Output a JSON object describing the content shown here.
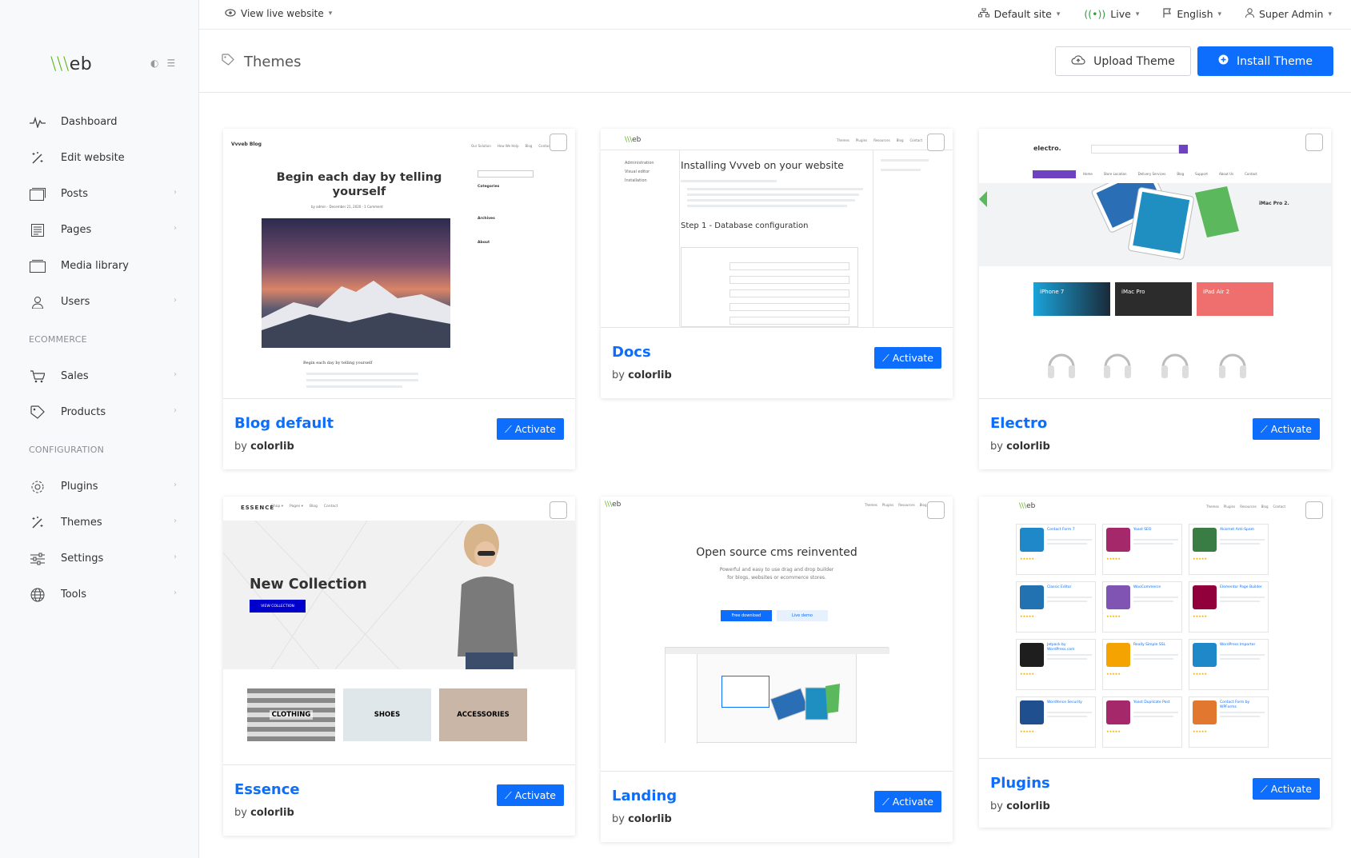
{
  "sidebar": {
    "logo": "Vvveb",
    "items": [
      {
        "label": "Dashboard",
        "icon": "activity-icon",
        "has_children": false
      },
      {
        "label": "Edit website",
        "icon": "magic-wand-icon",
        "has_children": false
      },
      {
        "label": "Posts",
        "icon": "posts-icon",
        "has_children": true
      },
      {
        "label": "Pages",
        "icon": "pages-icon",
        "has_children": true
      },
      {
        "label": "Media library",
        "icon": "media-icon",
        "has_children": false
      },
      {
        "label": "Users",
        "icon": "user-icon",
        "has_children": true
      }
    ],
    "section_ecommerce": "ECOMMERCE",
    "ecommerce_items": [
      {
        "label": "Sales",
        "icon": "cart-icon",
        "has_children": true
      },
      {
        "label": "Products",
        "icon": "tag-icon",
        "has_children": true
      }
    ],
    "section_configuration": "CONFIGURATION",
    "config_items": [
      {
        "label": "Plugins",
        "icon": "gear-icon",
        "has_children": true
      },
      {
        "label": "Themes",
        "icon": "magic-wand-icon",
        "has_children": true
      },
      {
        "label": "Settings",
        "icon": "sliders-icon",
        "has_children": true
      },
      {
        "label": "Tools",
        "icon": "globe-icon",
        "has_children": true
      }
    ]
  },
  "topbar": {
    "view_live": "View live website",
    "site": "Default site",
    "status": "Live",
    "language": "English",
    "user": "Super Admin"
  },
  "header": {
    "title": "Themes",
    "upload_label": "Upload Theme",
    "install_label": "Install Theme"
  },
  "themes": [
    {
      "name": "Blog default",
      "by_prefix": "by",
      "author": "colorlib",
      "action": "Activate"
    },
    {
      "name": "Docs",
      "by_prefix": "by",
      "author": "colorlib",
      "action": "Activate"
    },
    {
      "name": "Electro",
      "by_prefix": "by",
      "author": "colorlib",
      "action": "Activate"
    },
    {
      "name": "Essence",
      "by_prefix": "by",
      "author": "colorlib",
      "action": "Activate"
    },
    {
      "name": "Landing",
      "by_prefix": "by",
      "author": "colorlib",
      "action": "Activate"
    },
    {
      "name": "Plugins",
      "by_prefix": "by",
      "author": "colorlib",
      "action": "Activate"
    }
  ],
  "previews": {
    "blog": {
      "brand": "Vvveb Blog",
      "headline": "Begin each day by telling yourself",
      "categories": "Categories",
      "archives": "Archives",
      "about": "About",
      "caption": "Begin each day by telling yourself"
    },
    "docs": {
      "title": "Installing Vvveb on your website",
      "step": "Step 1 - Database configuration",
      "nav1": "Administration",
      "nav2": "Visual editor",
      "nav3": "Installation"
    },
    "electro": {
      "brand": "electro.",
      "ipad": "iMac Pro 2.",
      "tile1": "iPhone 7",
      "tile2": "iMac Pro",
      "tile3": "iPad Air 2"
    },
    "essence": {
      "brand": "ESSENCE",
      "headline": "New Collection",
      "cta": "VIEW COLLECTION",
      "c1": "CLOTHING",
      "c2": "SHOES",
      "c3": "ACCESSORIES"
    },
    "landing": {
      "headline": "Open source cms reinvented",
      "sub": "Powerful and easy to use drag and drop builder for blogs, websites or ecommerce stores.",
      "b1": "Free download",
      "b2": "Live demo"
    },
    "plugins": {
      "p1": "Contact Form 7",
      "p2": "Yoast SEO",
      "p3": "Akismet Anti-Spam",
      "p4": "Classic Editor",
      "p5": "WooCommerce",
      "p6": "Elementor Page Builder",
      "p7": "Jetpack by WordPress.com",
      "p8": "Really Simple SSL",
      "p9": "WordPress Importer",
      "p10": "Wordfence Security",
      "p11": "Yoast Duplicate Post",
      "p12": "Contact Form by WPForms"
    }
  },
  "colors": {
    "accent": "#0d6efd",
    "logo_green": "#5bb318"
  }
}
